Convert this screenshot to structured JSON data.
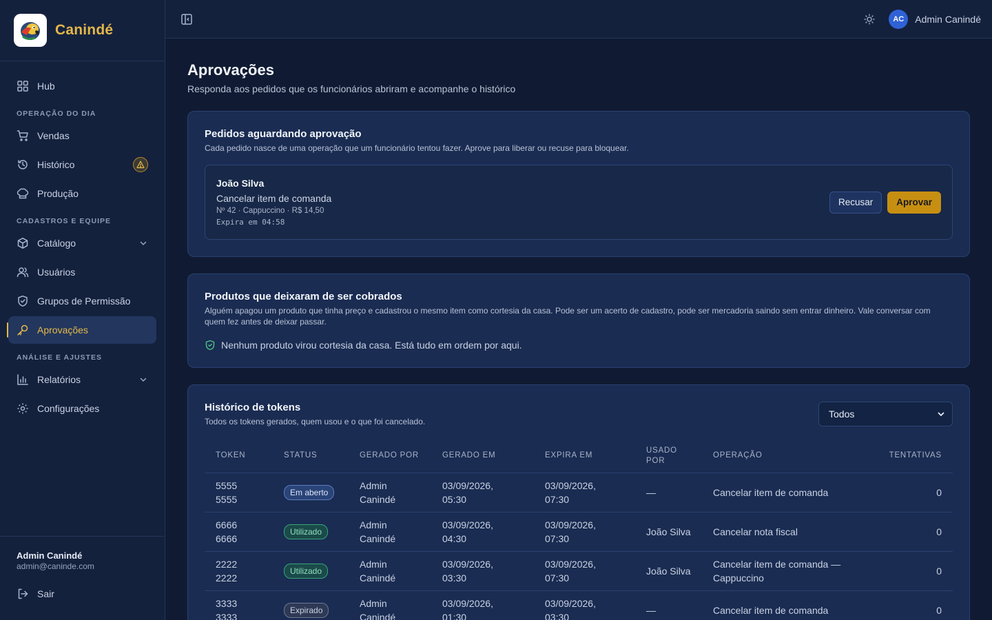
{
  "brand": {
    "name": "Canindé"
  },
  "sidebar": {
    "hub": "Hub",
    "sections": {
      "operacao": "OPERAÇÃO DO DIA",
      "cadastros": "CADASTROS E EQUIPE",
      "analise": "ANÁLISE E AJUSTES"
    },
    "items": {
      "vendas": "Vendas",
      "historico": "Histórico",
      "producao": "Produção",
      "catalogo": "Catálogo",
      "usuarios": "Usuários",
      "grupos": "Grupos de Permissão",
      "aprovacoes": "Aprovações",
      "relatorios": "Relatórios",
      "configuracoes": "Configurações"
    },
    "footer": {
      "name": "Admin Canindé",
      "email": "admin@caninde.com",
      "logout": "Sair"
    }
  },
  "topbar": {
    "avatar_initials": "AC",
    "user": "Admin Canindé"
  },
  "page": {
    "title": "Aprovações",
    "subtitle": "Responda aos pedidos que os funcionários abriram e acompanhe o histórico"
  },
  "pending": {
    "title": "Pedidos aguardando aprovação",
    "subtitle": "Cada pedido nasce de uma operação que um funcionário tentou fazer. Aprove para liberar ou recuse para bloquear.",
    "request": {
      "name": "João Silva",
      "operation": "Cancelar item de comanda",
      "detail": "Nº 42 · Cappuccino · R$ 14,50",
      "expires": "Expira em 04:58",
      "reject_label": "Recusar",
      "approve_label": "Aprovar"
    }
  },
  "courtesy": {
    "title": "Produtos que deixaram de ser cobrados",
    "subtitle": "Alguém apagou um produto que tinha preço e cadastrou o mesmo item como cortesia da casa. Pode ser um acerto de cadastro, pode ser mercadoria saindo sem entrar dinheiro. Vale conversar com quem fez antes de deixar passar.",
    "empty": "Nenhum produto virou cortesia da casa. Está tudo em ordem por aqui."
  },
  "history": {
    "title": "Histórico de tokens",
    "subtitle": "Todos os tokens gerados, quem usou e o que foi cancelado.",
    "filter_value": "Todos",
    "columns": {
      "token": "TOKEN",
      "status": "STATUS",
      "gerado_por": "GERADO POR",
      "gerado_em": "GERADO EM",
      "expira_em": "EXPIRA EM",
      "usado_por": "USADO POR",
      "operacao": "OPERAÇÃO",
      "tentativas": "TENTATIVAS"
    },
    "rows": [
      {
        "token": "5555 5555",
        "status": "Em aberto",
        "gerado_por": "Admin Canindé",
        "gerado_em": "03/09/2026, 05:30",
        "expira_em": "03/09/2026, 07:30",
        "usado_por": "—",
        "operacao": "Cancelar item de comanda",
        "tentativas": "0"
      },
      {
        "token": "6666 6666",
        "status": "Utilizado",
        "gerado_por": "Admin Canindé",
        "gerado_em": "03/09/2026, 04:30",
        "expira_em": "03/09/2026, 07:30",
        "usado_por": "João Silva",
        "operacao": "Cancelar nota fiscal",
        "tentativas": "0"
      },
      {
        "token": "2222 2222",
        "status": "Utilizado",
        "gerado_por": "Admin Canindé",
        "gerado_em": "03/09/2026, 03:30",
        "expira_em": "03/09/2026, 07:30",
        "usado_por": "João Silva",
        "operacao": "Cancelar item de comanda — Cappuccino",
        "tentativas": "0"
      },
      {
        "token": "3333 3333",
        "status": "Expirado",
        "gerado_por": "Admin Canindé",
        "gerado_em": "03/09/2026, 01:30",
        "expira_em": "03/09/2026, 03:30",
        "usado_por": "—",
        "operacao": "Cancelar item de comanda",
        "tentativas": "0"
      }
    ]
  },
  "icons": {
    "hub": "grid-icon",
    "vendas": "cart-icon",
    "historico": "history-icon",
    "producao": "chef-hat-icon",
    "catalogo": "box-icon",
    "usuarios": "users-icon",
    "grupos": "shield-icon",
    "aprovacoes": "key-icon",
    "relatorios": "bar-chart-icon",
    "configuracoes": "gear-icon",
    "logout": "logout-icon"
  },
  "colors": {
    "accent": "#e6b949",
    "approve": "#c78f12",
    "avatar": "#2f62d6",
    "success": "#4ec38a"
  }
}
